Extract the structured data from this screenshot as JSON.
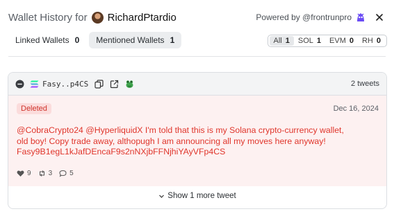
{
  "header": {
    "title_prefix": "Wallet History for",
    "username": "RichardPtardio",
    "powered_by": "Powered by @frontrunpro"
  },
  "tabs": [
    {
      "label": "Linked Wallets",
      "count": "0"
    },
    {
      "label": "Mentioned Wallets",
      "count": "1"
    }
  ],
  "filters": [
    {
      "label": "All",
      "count": "1"
    },
    {
      "label": "SOL",
      "count": "1"
    },
    {
      "label": "EVM",
      "count": "0"
    },
    {
      "label": "RH",
      "count": "0"
    }
  ],
  "wallet_card": {
    "address": "Fasy..p4CS",
    "tweet_count": "2 tweets",
    "tweet": {
      "status": "Deleted",
      "date": "Dec 16, 2024",
      "text_lines": [
        "@CobraCrypto24 @HyperliquidX I'm told that this is my Solana crypto-currency wallet,",
        "old boy! Copy trade away, althopugh I am announcing all my moves here anyway!",
        "Fasy9B1egL1kJafDEncaF9s2nNXjbFFNjhiYAyVFp4CS"
      ],
      "likes": "9",
      "retweets": "3",
      "replies": "5"
    },
    "show_more": "Show 1 more tweet"
  },
  "colors": {
    "deleted_text": "#e0352b",
    "deleted_bg": "#fdf1f1",
    "brand": "#6b4cf5"
  }
}
